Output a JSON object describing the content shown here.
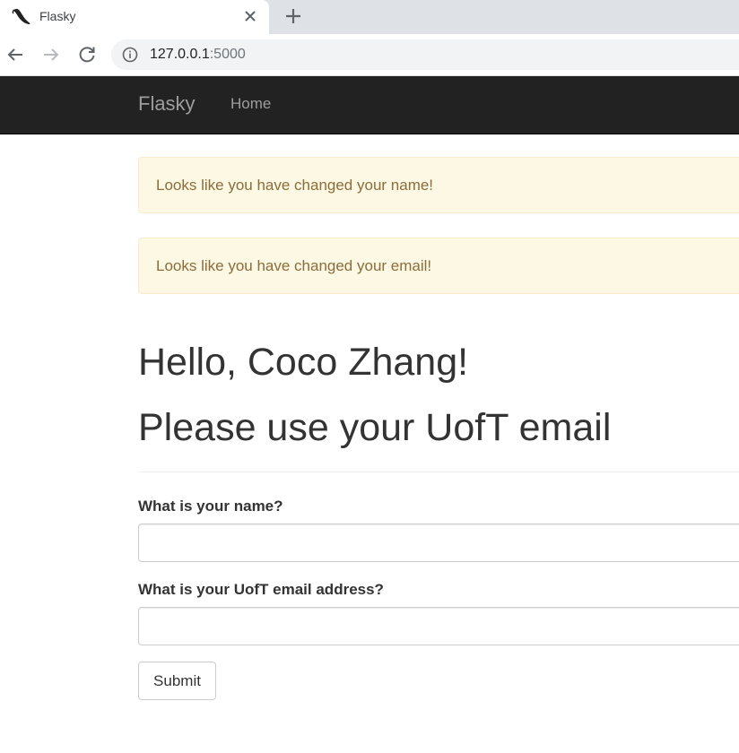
{
  "browser": {
    "tab": {
      "title": "Flasky",
      "favicon": "flask-horn-icon",
      "close_icon": "close-icon"
    },
    "new_tab_icon": "plus-icon",
    "nav": {
      "back_icon": "back-arrow-icon",
      "forward_icon": "forward-arrow-icon",
      "reload_icon": "reload-icon"
    },
    "address_bar": {
      "info_icon": "info-icon",
      "host": "127.0.0.1",
      "port": ":5000"
    }
  },
  "navbar": {
    "brand": "Flasky",
    "links": [
      {
        "label": "Home"
      }
    ]
  },
  "alerts": [
    {
      "message": "Looks like you have changed your name!"
    },
    {
      "message": "Looks like you have changed your email!"
    }
  ],
  "page_header": {
    "greeting": "Hello, Coco Zhang!",
    "subheading": "Please use your UofT email"
  },
  "form": {
    "name_label": "What is your name?",
    "name_value": "",
    "email_label": "What is your UofT email address?",
    "email_value": "",
    "submit_label": "Submit"
  },
  "colors": {
    "navbar_bg": "#222222",
    "navbar_text": "#9d9d9d",
    "alert_bg": "#fcf8e3",
    "alert_border": "#faebcc",
    "alert_text": "#8a6d3b",
    "heading_text": "#333333"
  }
}
